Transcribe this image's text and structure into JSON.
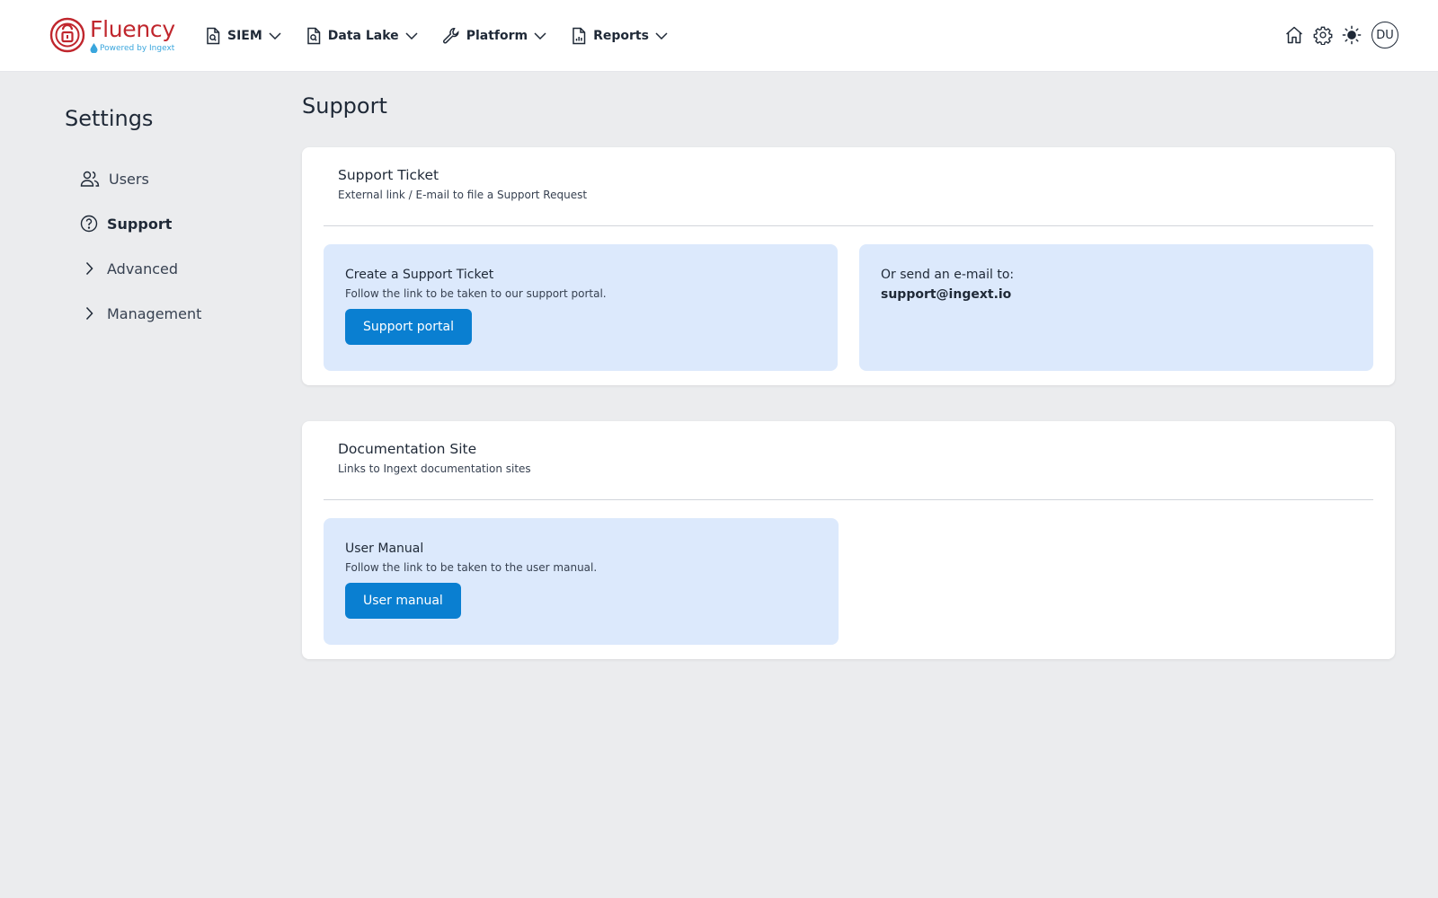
{
  "brand": {
    "name": "Fluency",
    "tagline": "Powered by Ingext",
    "color": "#c0262d",
    "accent": "#3aa6dd"
  },
  "nav": {
    "items": [
      {
        "label": "SIEM",
        "icon": "document-search-icon"
      },
      {
        "label": "Data Lake",
        "icon": "document-search-icon"
      },
      {
        "label": "Platform",
        "icon": "wrench-icon"
      },
      {
        "label": "Reports",
        "icon": "report-chart-icon"
      }
    ]
  },
  "user": {
    "initials": "DU"
  },
  "sidebar": {
    "title": "Settings",
    "items": [
      {
        "label": "Users",
        "icon": "users-icon"
      },
      {
        "label": "Support",
        "icon": "help-circle-icon",
        "active": true
      },
      {
        "label": "Advanced",
        "icon": "chevron-right-icon"
      },
      {
        "label": "Management",
        "icon": "chevron-right-icon"
      }
    ]
  },
  "page": {
    "title": "Support"
  },
  "support_ticket": {
    "title": "Support Ticket",
    "subtitle": "External link / E-mail to file a Support Request",
    "create": {
      "title": "Create a Support Ticket",
      "subtitle": "Follow the link to be taken to our support portal.",
      "button": "Support portal"
    },
    "email": {
      "label": "Or send an e-mail to:",
      "address": "support@ingext.io"
    }
  },
  "documentation": {
    "title": "Documentation Site",
    "subtitle": "Links to Ingext documentation sites",
    "manual": {
      "title": "User Manual",
      "subtitle": "Follow the link to be taken to the user manual.",
      "button": "User manual"
    }
  },
  "colors": {
    "button": "#0a7fd1",
    "tile": "#dce9fc",
    "background": "#ebecee"
  }
}
